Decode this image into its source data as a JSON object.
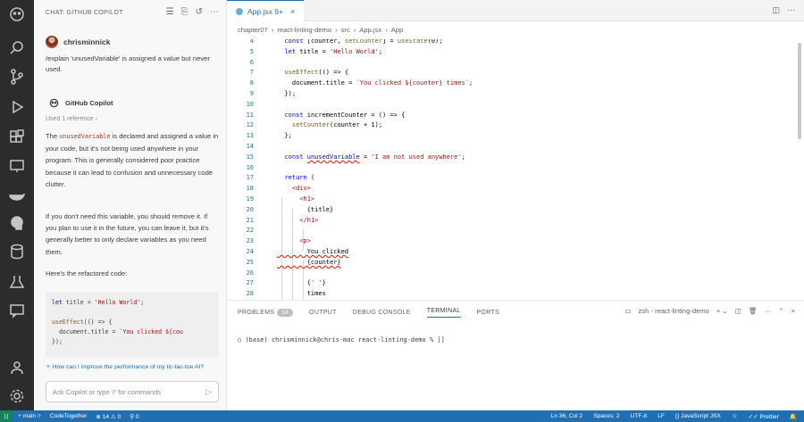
{
  "chat": {
    "header_title": "CHAT: GITHUB COPILOT",
    "user_name": "chrisminnick",
    "user_message": "/explain 'unusedVariable' is assigned a value but never used.",
    "copilot_name": "GitHub Copilot",
    "references": "Used 1 reference",
    "para1_before": "The ",
    "para1_code": "unusedVariable",
    "para1_after": " is declared and assigned a value in your code, but it's not being used anywhere in your program. This is generally considered poor practice because it can lead to confusion and unnecessary code clutter.",
    "para2": "If you don't need this variable, you should remove it. If you plan to use it in the future, you can leave it, but it's generally better to only declare variables as you need them.",
    "para3": "Here's the refactored code:",
    "code_lines": [
      "let title = 'Hello World';",
      "",
      "useEffect(() => {",
      "  document.title = `You clicked ${cou",
      "});"
    ],
    "followup": "How can I improve the performance of my tic-tac-toe AI?",
    "input_placeholder": "Ask Copilot or type '/' for commands"
  },
  "editor": {
    "tab_label": "App.jsx 9+",
    "breadcrumb": [
      "chapter07",
      "react-linting-demo",
      "src",
      "App.jsx",
      "App"
    ],
    "lines": [
      {
        "n": "4",
        "t": "  const [counter, setCounter] = useState(0);"
      },
      {
        "n": "5",
        "t": "  let title = 'Hello World';"
      },
      {
        "n": "6",
        "t": ""
      },
      {
        "n": "7",
        "t": "  useEffect(() => {"
      },
      {
        "n": "8",
        "t": "    document.title = `You clicked ${counter} times`;"
      },
      {
        "n": "9",
        "t": "  });"
      },
      {
        "n": "10",
        "t": ""
      },
      {
        "n": "11",
        "t": "  const incrementCounter = () => {"
      },
      {
        "n": "12",
        "t": "    setCounter(counter + 1);"
      },
      {
        "n": "13",
        "t": "  };"
      },
      {
        "n": "14",
        "t": ""
      },
      {
        "n": "15",
        "t": "  const unusedVariable = 'I am not used anywhere';"
      },
      {
        "n": "16",
        "t": ""
      },
      {
        "n": "17",
        "t": "  return ("
      },
      {
        "n": "18",
        "t": "    <div>"
      },
      {
        "n": "19",
        "t": "      <h1>"
      },
      {
        "n": "20",
        "t": "        {title}"
      },
      {
        "n": "21",
        "t": "      </h1>"
      },
      {
        "n": "22",
        "t": ""
      },
      {
        "n": "23",
        "t": "      <p>"
      },
      {
        "n": "24",
        "t": "        You clicked"
      },
      {
        "n": "25",
        "t": "        {counter}"
      },
      {
        "n": "26",
        "t": ""
      },
      {
        "n": "27",
        "t": "        {' '}"
      },
      {
        "n": "28",
        "t": "        times"
      }
    ]
  },
  "panel": {
    "tabs": [
      "PROBLEMS",
      "OUTPUT",
      "DEBUG CONSOLE",
      "TERMINAL",
      "PORTS"
    ],
    "problems_count": "14",
    "terminal_name": "zsh - react-linting-demo",
    "terminal_line": "(base) chrisminnick@chris-mac react-linting-demo % []"
  },
  "status": {
    "branch": "main",
    "codetogether": "CodeTogether",
    "errors": "14",
    "warnings": "0",
    "ports": "0",
    "cursor": "Ln 36, Col 2",
    "spaces": "Spaces: 2",
    "encoding": "UTF-8",
    "eol": "LF",
    "language": "JavaScript JSX",
    "prettier": "Prettier"
  }
}
